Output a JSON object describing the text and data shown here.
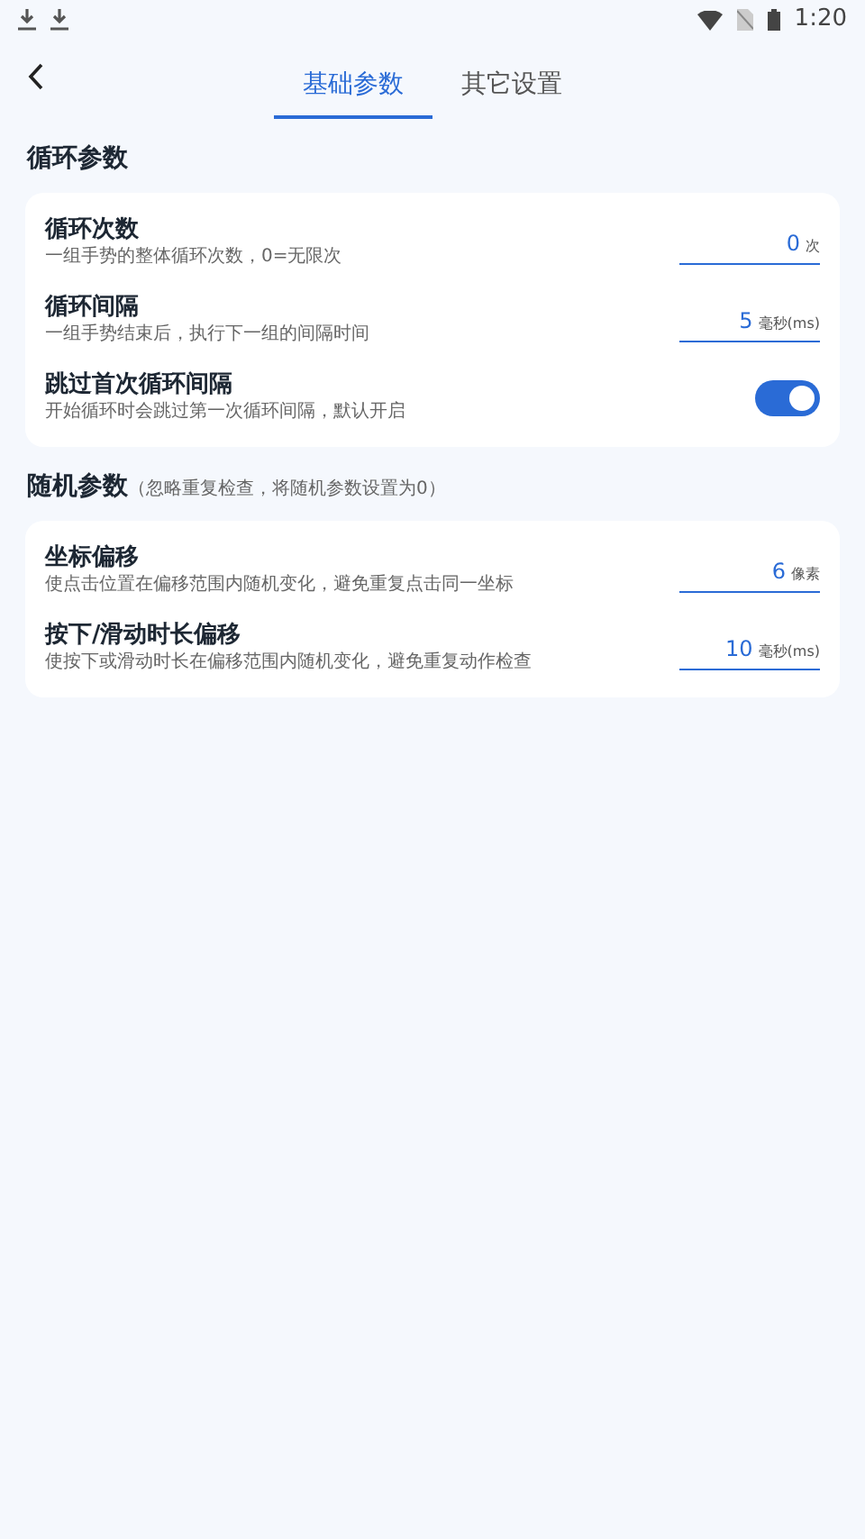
{
  "status_bar": {
    "time": "1:20"
  },
  "tabs": [
    {
      "label": "基础参数",
      "selected": true
    },
    {
      "label": "其它设置",
      "selected": false
    }
  ],
  "sections": [
    {
      "title": "循环参数",
      "rows": [
        {
          "kind": "number",
          "title": "循环次数",
          "description": "一组手势的整体循环次数，0=无限次",
          "value": "0",
          "unit": "次"
        },
        {
          "kind": "number",
          "title": "循环间隔",
          "description": "一组手势结束后，执行下一组的间隔时间",
          "value": "5",
          "unit": "毫秒(ms)"
        },
        {
          "kind": "toggle",
          "title": "跳过首次循环间隔",
          "description": "开始循环时会跳过第一次循环间隔，默认开启",
          "on": true
        }
      ]
    },
    {
      "title": "随机参数",
      "note": "（忽略重复检查，将随机参数设置为0）",
      "rows": [
        {
          "kind": "number",
          "title": "坐标偏移",
          "description": "使点击位置在偏移范围内随机变化，避免重复点击同一坐标",
          "value": "6",
          "unit": "像素"
        },
        {
          "kind": "number",
          "title": "按下/滑动时长偏移",
          "description": "使按下或滑动时长在偏移范围内随机变化，避免重复动作检查",
          "value": "10",
          "unit": "毫秒(ms)"
        }
      ]
    }
  ]
}
